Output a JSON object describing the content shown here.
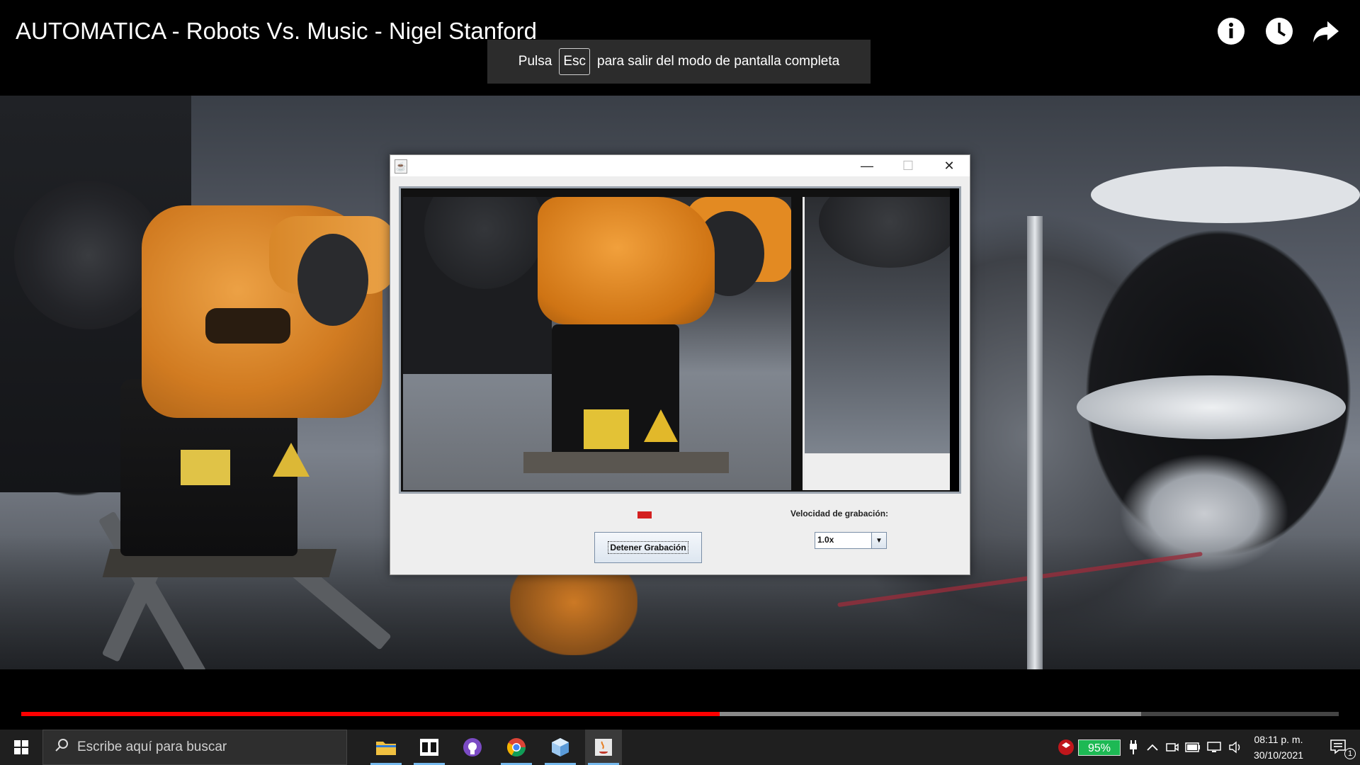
{
  "video": {
    "title": "AUTOMATICA - Robots Vs. Music - Nigel Stanford",
    "fullscreen_toast": {
      "before": "Pulsa",
      "key": "Esc",
      "after": "para salir del modo de pantalla completa"
    },
    "progress_played_fraction": 0.53,
    "progress_buffered_fraction": 0.85,
    "icons": [
      "info-icon",
      "clock-icon",
      "share-icon"
    ]
  },
  "app_window": {
    "icon": "java-icon",
    "stop_button_label": "Detener Grabación",
    "speed_label": "Velocidad de grabación:",
    "speed_value": "1.0x",
    "recording_indicator_color": "#d32020"
  },
  "taskbar": {
    "search_placeholder": "Escribe aquí para buscar",
    "apps": [
      "file-explorer-icon",
      "media-app-icon",
      "github-desktop-icon",
      "chrome-icon",
      "cube-app-icon",
      "java-app-icon"
    ],
    "battery": "95%",
    "time": "08:11 p. m.",
    "date": "30/10/2021",
    "notifications_count": "1"
  },
  "colors": {
    "progress": "#ff0000",
    "taskbar_accent": "#76b9ed",
    "battery": "#1db954"
  }
}
